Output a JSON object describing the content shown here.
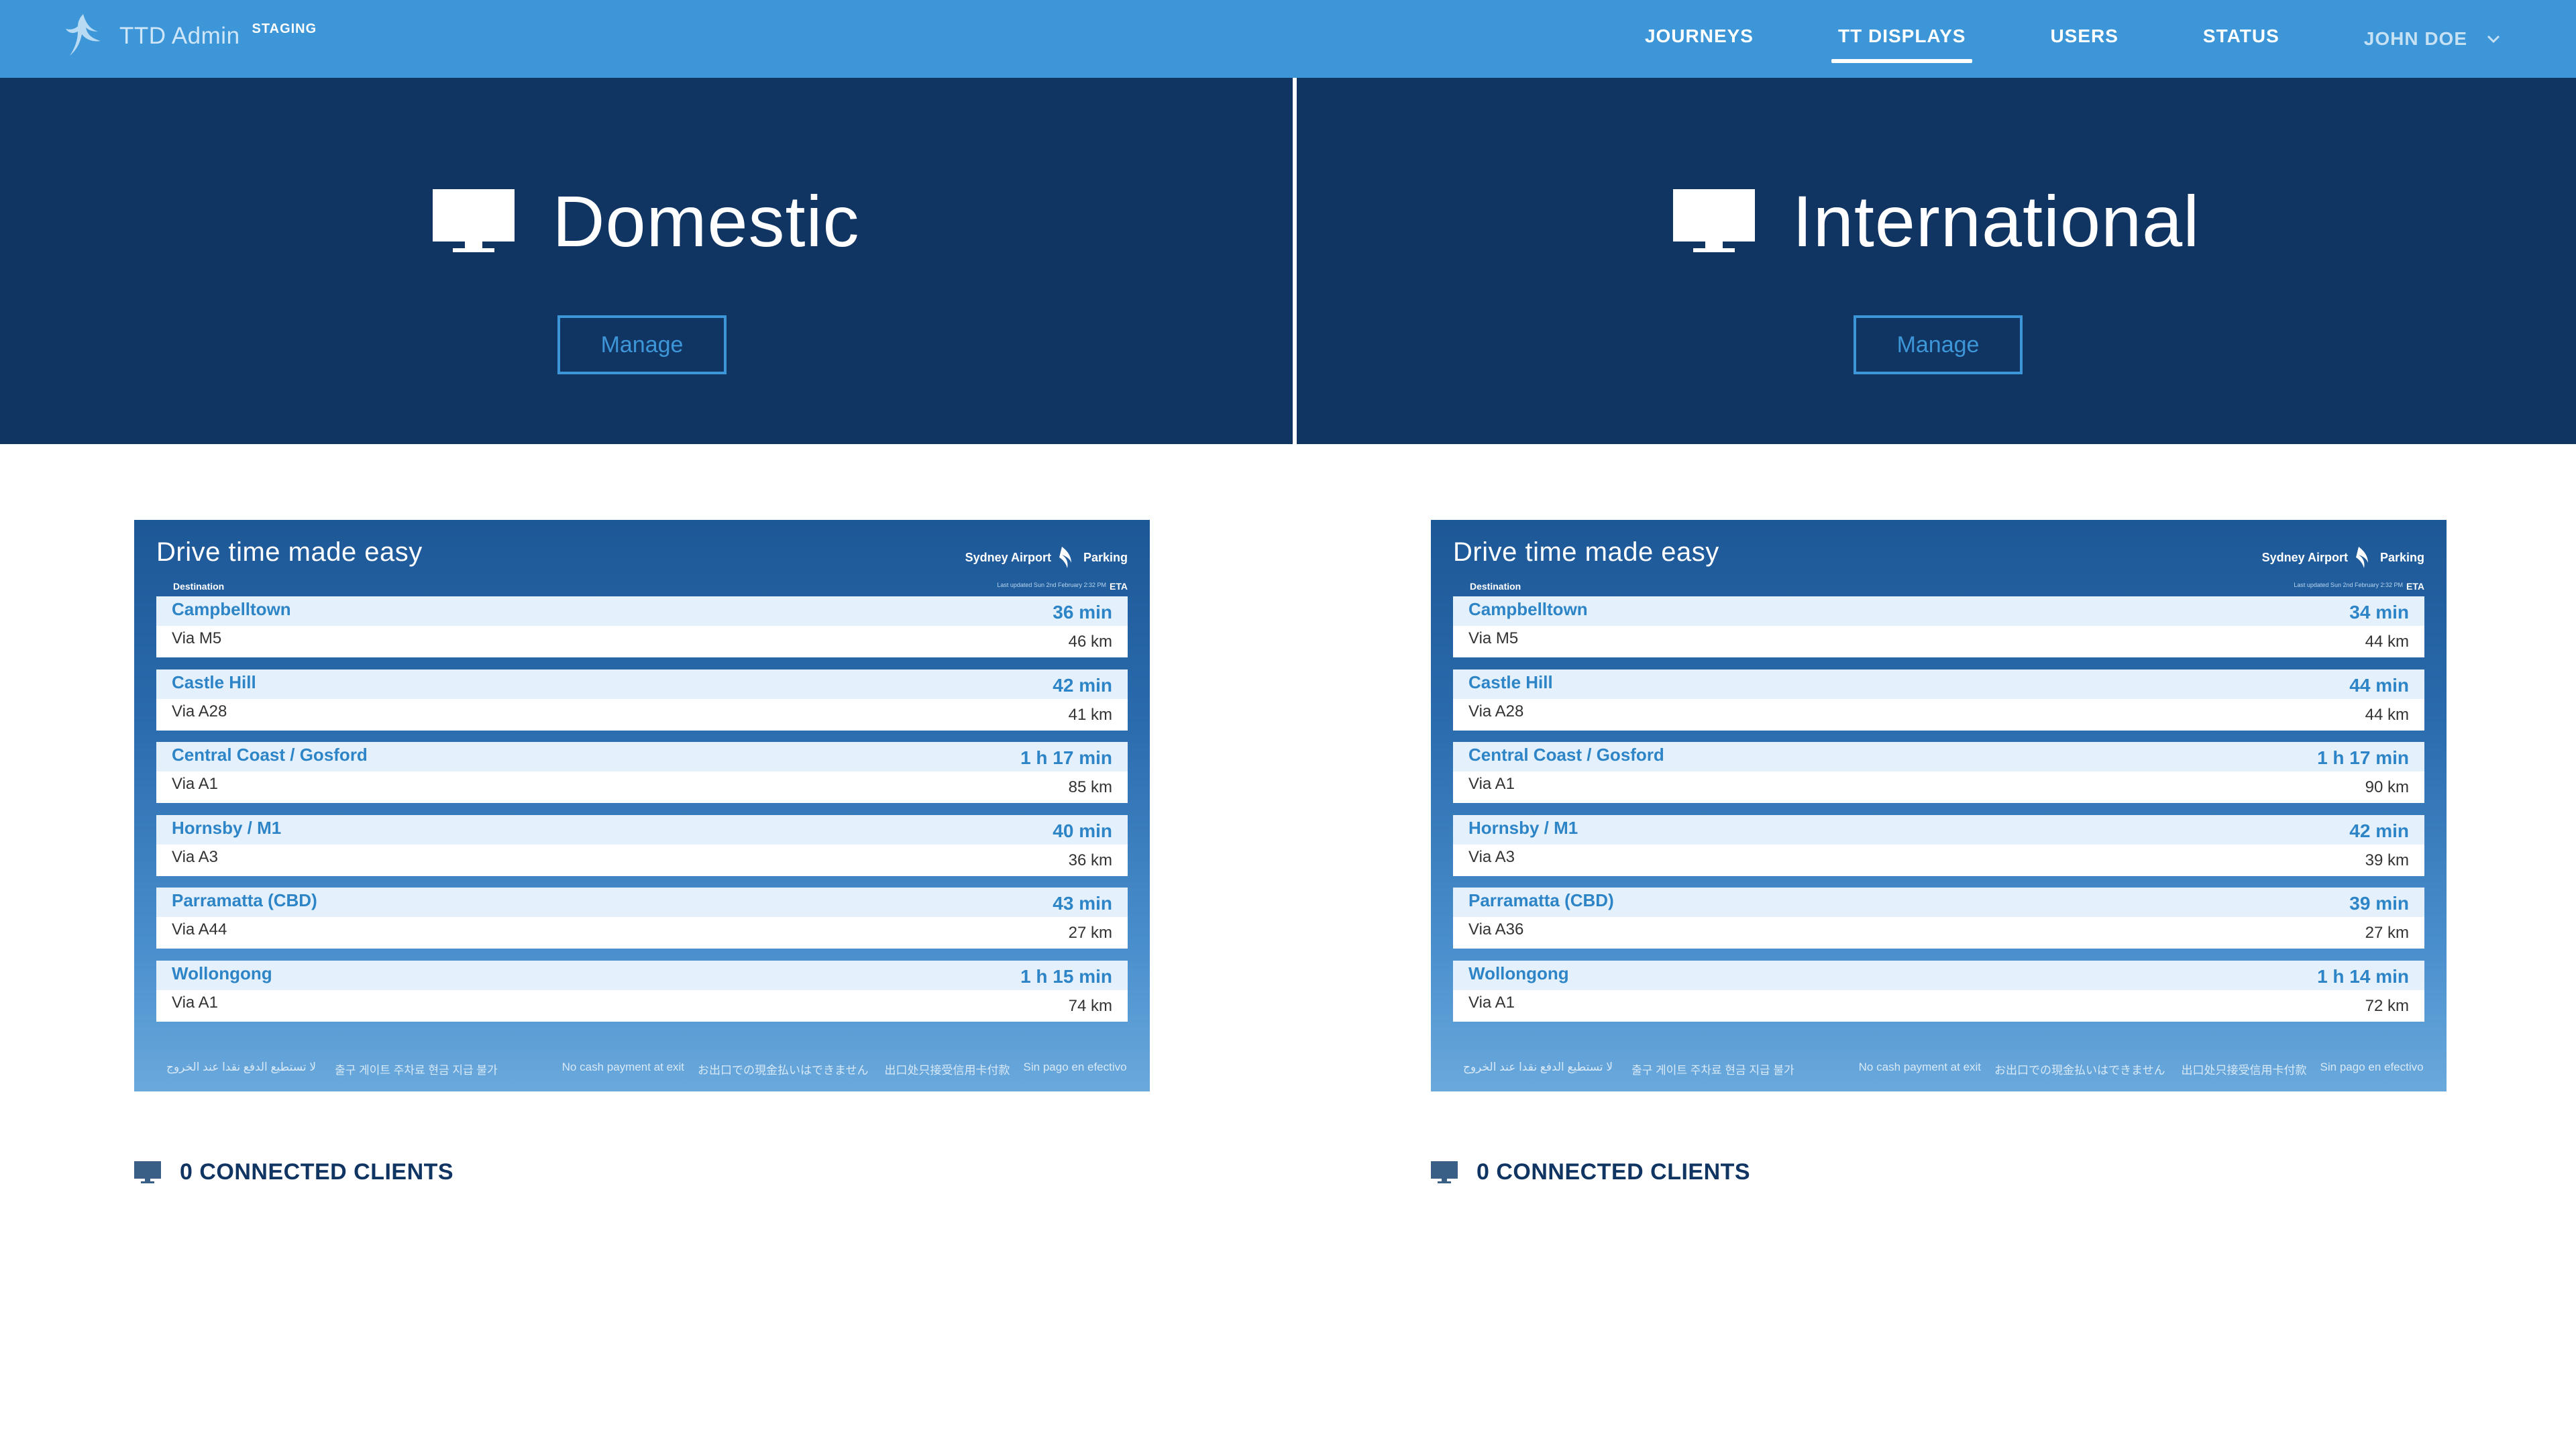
{
  "nav": {
    "brand_name": "TTD Admin",
    "environment": "STAGING",
    "items": [
      {
        "label": "JOURNEYS",
        "active": false
      },
      {
        "label": "TT DISPLAYS",
        "active": true
      },
      {
        "label": "USERS",
        "active": false
      },
      {
        "label": "STATUS",
        "active": false
      }
    ],
    "user": "JOHN DOE",
    "icons": {
      "logo": "bird-logo-icon",
      "user_menu": "chevron-down-icon"
    }
  },
  "displays": [
    {
      "name": "Domestic",
      "manage_label": "Manage",
      "icon": "monitor-icon",
      "clients_text": "0 CONNECTED CLIENTS",
      "board": {
        "headline": "Drive time made easy",
        "brand_left": "Sydney Airport",
        "brand_right": "Parking",
        "destination_header": "Destination",
        "eta_header": "ETA",
        "updated": "Last updated Sun 2nd February 2:32 PM",
        "rows": [
          {
            "destination": "Campbelltown",
            "via": "Via M5",
            "time": "36 min",
            "distance": "46 km"
          },
          {
            "destination": "Castle Hill",
            "via": "Via A28",
            "time": "42 min",
            "distance": "41 km"
          },
          {
            "destination": "Central Coast / Gosford",
            "via": "Via A1",
            "time": "1 h 17 min",
            "distance": "85 km"
          },
          {
            "destination": "Hornsby / M1",
            "via": "Via A3",
            "time": "40 min",
            "distance": "36 km"
          },
          {
            "destination": "Parramatta (CBD)",
            "via": "Via A44",
            "time": "43 min",
            "distance": "27 km"
          },
          {
            "destination": "Wollongong",
            "via": "Via A1",
            "time": "1 h 15 min",
            "distance": "74 km"
          }
        ],
        "footer": {
          "arabic": "لا تستطيع الدفع نقدا عند الخروج",
          "korean": "출구 게이트 주차료 현금 지급 불가",
          "english": "No cash payment at exit",
          "japanese": "お出口での現金払いはできません",
          "chinese": "出口处只接受信用卡付款",
          "spanish": "Sin pago en efectivo a la salida"
        }
      }
    },
    {
      "name": "International",
      "manage_label": "Manage",
      "icon": "monitor-icon",
      "clients_text": "0 CONNECTED CLIENTS",
      "board": {
        "headline": "Drive time made easy",
        "brand_left": "Sydney Airport",
        "brand_right": "Parking",
        "destination_header": "Destination",
        "eta_header": "ETA",
        "updated": "Last updated Sun 2nd February 2:32 PM",
        "rows": [
          {
            "destination": "Campbelltown",
            "via": "Via M5",
            "time": "34 min",
            "distance": "44 km"
          },
          {
            "destination": "Castle Hill",
            "via": "Via A28",
            "time": "44 min",
            "distance": "44 km"
          },
          {
            "destination": "Central Coast / Gosford",
            "via": "Via A1",
            "time": "1 h 17 min",
            "distance": "90 km"
          },
          {
            "destination": "Hornsby / M1",
            "via": "Via A3",
            "time": "42 min",
            "distance": "39 km"
          },
          {
            "destination": "Parramatta (CBD)",
            "via": "Via A36",
            "time": "39 min",
            "distance": "27 km"
          },
          {
            "destination": "Wollongong",
            "via": "Via A1",
            "time": "1 h 14 min",
            "distance": "72 km"
          }
        ],
        "footer": {
          "arabic": "لا تستطيع الدفع نقدا عند الخروج",
          "korean": "출구 게이트 주차료 현금 지급 불가",
          "english": "No cash payment at exit",
          "japanese": "お出口での現金払いはできません",
          "chinese": "出口处只接受信用卡付款",
          "spanish": "Sin pago en efectivo a la salida"
        }
      }
    }
  ]
}
